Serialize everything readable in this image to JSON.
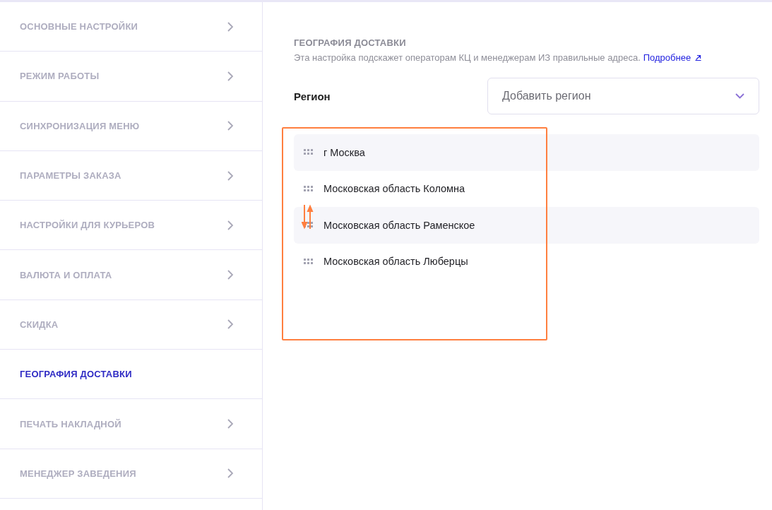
{
  "sidebar": {
    "items": [
      {
        "label": "ОСНОВНЫЕ НАСТРОЙКИ",
        "selected": false
      },
      {
        "label": "РЕЖИМ РАБОТЫ",
        "selected": false
      },
      {
        "label": "СИНХРОНИЗАЦИЯ МЕНЮ",
        "selected": false
      },
      {
        "label": "ПАРАМЕТРЫ ЗАКАЗА",
        "selected": false
      },
      {
        "label": "НАСТРОЙКИ ДЛЯ КУРЬЕРОВ",
        "selected": false
      },
      {
        "label": "ВАЛЮТА И ОПЛАТА",
        "selected": false
      },
      {
        "label": "СКИДКА",
        "selected": false
      },
      {
        "label": "ГЕОГРАФИЯ ДОСТАВКИ",
        "selected": true
      },
      {
        "label": "ПЕЧАТЬ НАКЛАДНОЙ",
        "selected": false
      },
      {
        "label": "МЕНЕДЖЕР ЗАВЕДЕНИЯ",
        "selected": false
      }
    ]
  },
  "section": {
    "title": "ГЕОГРАФИЯ ДОСТАВКИ",
    "description": "Эта настройка подскажет операторам КЦ и менеджерам ИЗ правильные адреса.",
    "link": "Подробнее"
  },
  "region_field": {
    "label": "Регион",
    "placeholder": "Добавить регион"
  },
  "regions": [
    {
      "name": "г Москва"
    },
    {
      "name": "Московская область Коломна"
    },
    {
      "name": "Московская область Раменское"
    },
    {
      "name": "Московская область Люберцы"
    }
  ]
}
